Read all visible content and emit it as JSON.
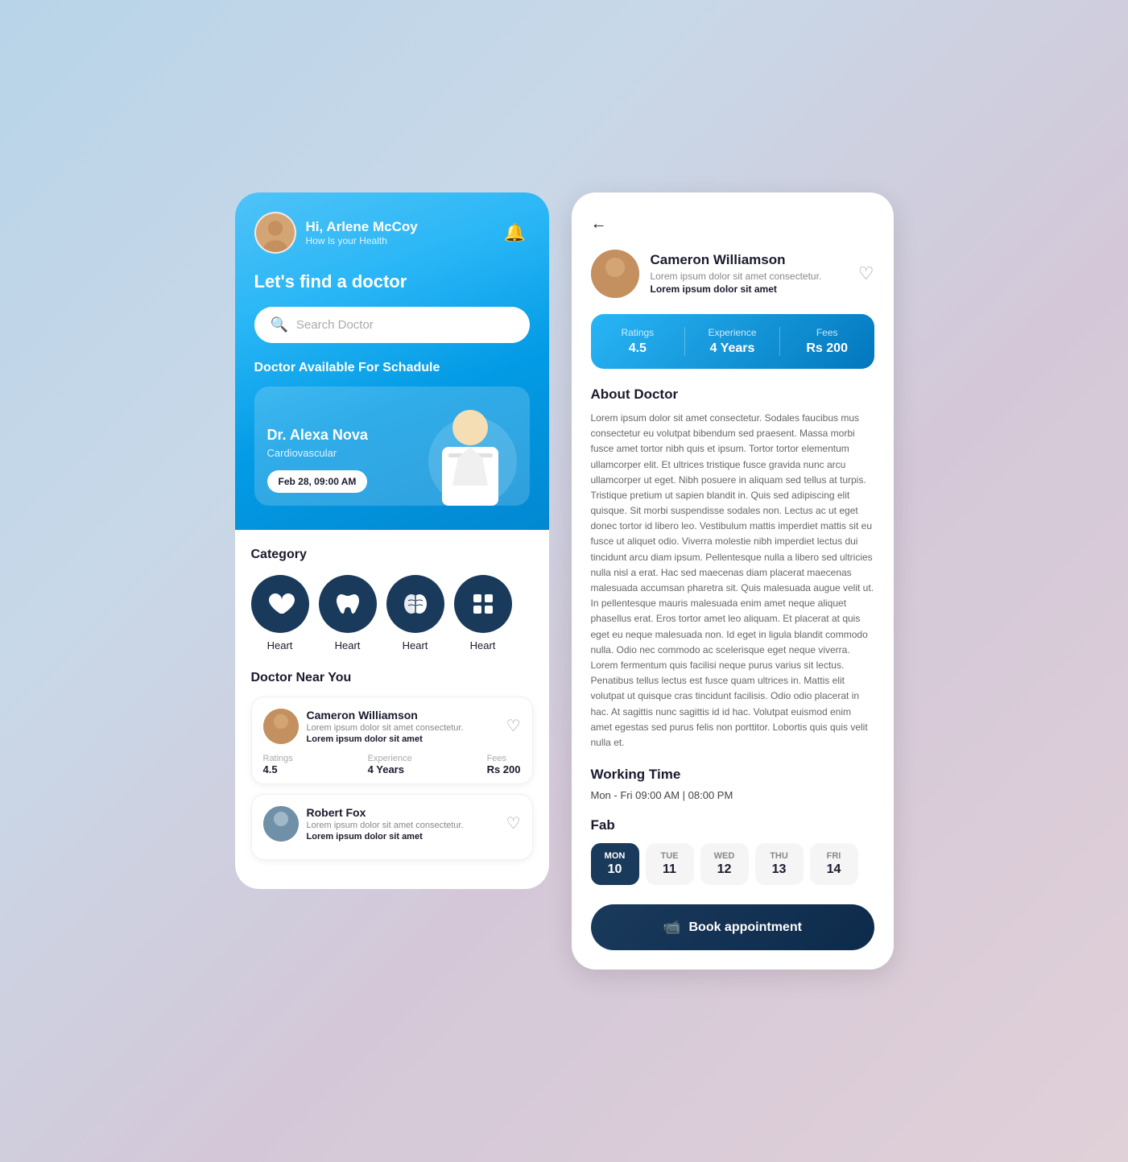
{
  "left": {
    "header": {
      "greeting": "Hi, Arlene McCoy",
      "subtitle": "How Is your Health"
    },
    "find_title": "Let's find a doctor",
    "search_placeholder": "Search Doctor",
    "schedule_title": "Doctor Available For Schadule",
    "featured_doctor": {
      "name": "Dr. Alexa Nova",
      "specialty": "Cardiovascular",
      "time": "Feb 28, 09:00 AM"
    },
    "category_title": "Category",
    "categories": [
      {
        "label": "Heart",
        "icon": "❤"
      },
      {
        "label": "Heart",
        "icon": "🦷"
      },
      {
        "label": "Heart",
        "icon": "🧠"
      },
      {
        "label": "Heart",
        "icon": "⊞"
      }
    ],
    "nearby_title": "Doctor Near You",
    "nearby_doctors": [
      {
        "name": "Cameron Williamson",
        "sub": "Lorem ipsum dolor sit amet consectetur.",
        "bold": "Lorem ipsum dolor sit amet",
        "ratings_label": "Ratings",
        "ratings_value": "4.5",
        "exp_label": "Experience",
        "exp_value": "4 Years",
        "fees_label": "Fees",
        "fees_value": "Rs 200"
      },
      {
        "name": "Robert Fox",
        "sub": "Lorem ipsum dolor sit amet consectetur.",
        "bold": "Lorem ipsum dolor sit amet",
        "ratings_label": "",
        "ratings_value": "",
        "exp_label": "",
        "exp_value": "",
        "fees_label": "",
        "fees_value": ""
      }
    ]
  },
  "right": {
    "back_arrow": "←",
    "doctor": {
      "name": "Cameron Williamson",
      "sub": "Lorem ipsum dolor sit amet consectetur.",
      "bold": "Lorem ipsum dolor sit amet"
    },
    "stats": {
      "ratings_label": "Ratings",
      "ratings_value": "4.5",
      "exp_label": "Experience",
      "exp_value": "4 Years",
      "fees_label": "Fees",
      "fees_value": "Rs 200"
    },
    "about_title": "About Doctor",
    "about_text": "Lorem ipsum dolor sit amet consectetur. Sodales faucibus mus consectetur eu volutpat bibendum sed praesent. Massa morbi fusce amet tortor nibh quis et ipsum. Tortor tortor elementum ullamcorper elit. Et ultrices tristique fusce gravida nunc arcu ullamcorper ut eget. Nibh posuere in aliquam sed tellus at turpis. Tristique pretium ut sapien blandit in. Quis sed adipiscing elit quisque. Sit morbi suspendisse sodales non. Lectus ac ut eget donec tortor id libero leo. Vestibulum mattis imperdiet mattis sit eu fusce ut aliquet odio. Viverra molestie nibh imperdiet lectus dui tincidunt arcu diam ipsum. Pellentesque nulla a libero sed ultricies nulla nisl a erat. Hac sed maecenas diam placerat maecenas malesuada accumsan pharetra sit. Quis malesuada augue velit ut. In pellentesque mauris malesuada enim amet neque aliquet phasellus erat. Eros tortor amet leo aliquam. Et placerat at quis eget eu neque malesuada non. Id eget in ligula blandit commodo nulla. Odio nec commodo ac scelerisque eget neque viverra. Lorem fermentum quis facilisi neque purus varius sit lectus. Penatibus tellus lectus est fusce quam ultrices in. Mattis elit volutpat ut quisque cras tincidunt facilisis. Odio odio placerat in hac. At sagittis nunc sagittis id id hac. Volutpat euismod enim amet egestas sed purus felis non porttitor. Lobortis quis quis velit nulla et.",
    "working_title": "Working Time",
    "working_time": "Mon - Fri 09:00 AM | 08:00 PM",
    "fab_title": "Fab",
    "days": [
      {
        "name": "MON",
        "num": "10",
        "active": true
      },
      {
        "name": "TUE",
        "num": "11",
        "active": false
      },
      {
        "name": "WED",
        "num": "12",
        "active": false
      },
      {
        "name": "THU",
        "num": "13",
        "active": false
      },
      {
        "name": "FRI",
        "num": "14",
        "active": false
      }
    ],
    "book_btn": "Book appointment"
  }
}
